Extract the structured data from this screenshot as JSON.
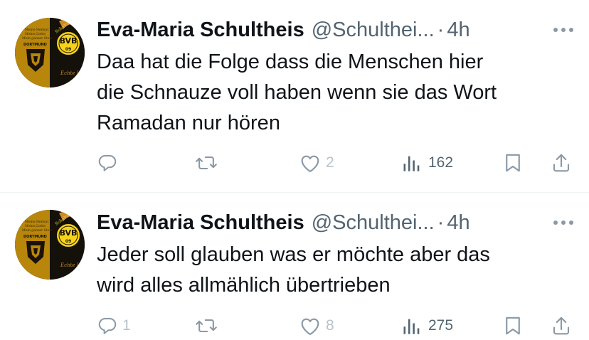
{
  "colors": {
    "name": "#0f1419",
    "secondary": "#536471",
    "icon": "#8b98a5",
    "divider": "#eff3f4",
    "avatar_gold": "#b8860b",
    "bvb_yellow": "#f6d31b"
  },
  "tweets": [
    {
      "author": {
        "name": "Eva-Maria Schultheis",
        "handle": "@Schulthei...",
        "avatar_icon": "bvb-crest-avatar",
        "avatar_text": [
          "Meine Heimat",
          "Meine Liebe",
          "Mein ganzer Stolz",
          "DORTMUND",
          "Schultheis",
          "Echte Liebe",
          "BVB",
          "09"
        ]
      },
      "separator": "·",
      "time": "4h",
      "more_icon": "ellipsis-icon",
      "text": "Daa hat die Folge dass die Menschen hier\ndie Schnauze voll haben wenn sie das Wort\nRamadan nur hören",
      "actions": {
        "reply": {
          "icon": "reply-icon",
          "count": ""
        },
        "retweet": {
          "icon": "retweet-icon",
          "count": ""
        },
        "like": {
          "icon": "heart-icon",
          "count": "2"
        },
        "views": {
          "icon": "views-icon",
          "count": "162"
        },
        "bookmark": {
          "icon": "bookmark-icon"
        },
        "share": {
          "icon": "share-icon"
        }
      }
    },
    {
      "author": {
        "name": "Eva-Maria Schultheis",
        "handle": "@Schulthei...",
        "avatar_icon": "bvb-crest-avatar",
        "avatar_text": [
          "Meine Heimat",
          "Meine Liebe",
          "Mein ganzer Stolz",
          "DORTMUND",
          "Schultheis",
          "Echte Liebe",
          "BVB",
          "09"
        ]
      },
      "separator": "·",
      "time": "4h",
      "more_icon": "ellipsis-icon",
      "text": "Jeder soll glauben was er möchte aber das\nwird alles allmählich übertrieben",
      "actions": {
        "reply": {
          "icon": "reply-icon",
          "count": "1"
        },
        "retweet": {
          "icon": "retweet-icon",
          "count": ""
        },
        "like": {
          "icon": "heart-icon",
          "count": "8"
        },
        "views": {
          "icon": "views-icon",
          "count": "275"
        },
        "bookmark": {
          "icon": "bookmark-icon"
        },
        "share": {
          "icon": "share-icon"
        }
      }
    }
  ]
}
